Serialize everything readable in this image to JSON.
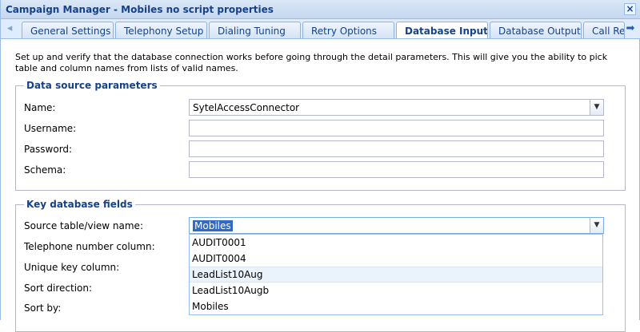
{
  "window": {
    "title": "Campaign Manager - Mobiles no script properties",
    "close_label": "×"
  },
  "tabs": [
    {
      "label": "General Settings",
      "active": false
    },
    {
      "label": "Telephony Setup",
      "active": false
    },
    {
      "label": "Dialing Tuning",
      "active": false
    },
    {
      "label": "Retry Options",
      "active": false
    },
    {
      "label": "Database Input",
      "active": true
    },
    {
      "label": "Database Output",
      "active": false
    },
    {
      "label": "Call Rec",
      "active": false
    }
  ],
  "tab_scroll": {
    "left_icon": "arrow-left-icon",
    "right_icon": "arrow-right-icon",
    "left_glyph": "◆",
    "right_glyph": "➡"
  },
  "intro_text": "Set up and verify that the database connection works before going through the detail parameters. This will give you the ability to pick table and column names from lists of valid names.",
  "data_source": {
    "legend": "Data source parameters",
    "name_label": "Name:",
    "name_value": "SytelAccessConnector",
    "username_label": "Username:",
    "username_value": "",
    "password_label": "Password:",
    "password_value": "",
    "schema_label": "Schema:",
    "schema_value": ""
  },
  "key_fields": {
    "legend": "Key database fields",
    "source_table_label": "Source table/view name:",
    "source_table_value": "Mobiles",
    "telephone_label": "Telephone number column:",
    "unique_key_label": "Unique key column:",
    "sort_direction_label": "Sort direction:",
    "sort_by_label": "Sort by:"
  },
  "dropdown": {
    "options": [
      "AUDIT0001",
      "AUDIT0004",
      "LeadList10Aug",
      "LeadList10Augb",
      "Mobiles"
    ],
    "hovered": "LeadList10Aug"
  },
  "combo_arrow_glyph": "▼",
  "colors": {
    "accent": "#15428b",
    "border": "#99bbe8",
    "selection": "#316ac5"
  }
}
